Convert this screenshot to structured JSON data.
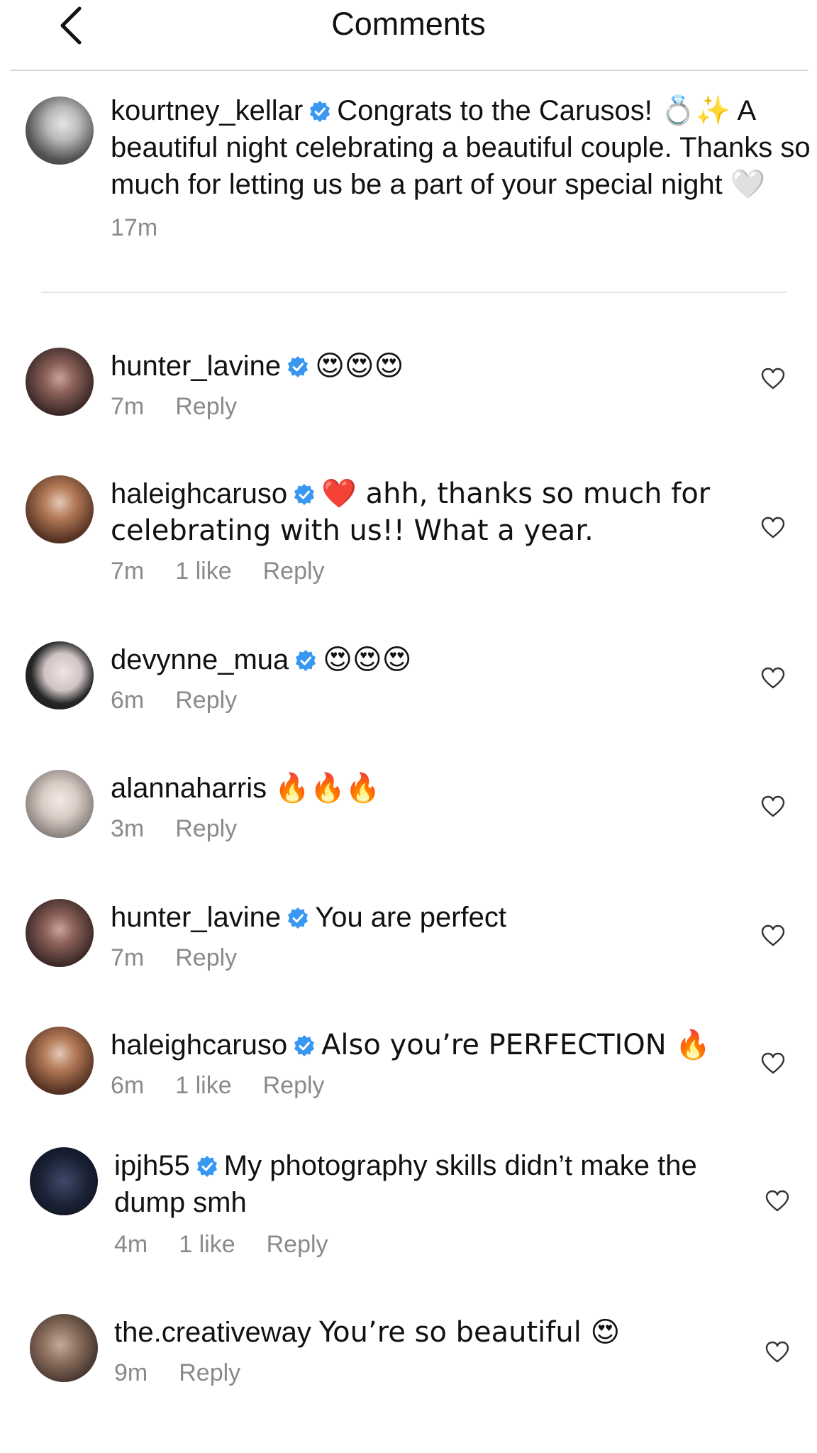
{
  "header": {
    "title": "Comments",
    "back_icon": "chevron-left-icon"
  },
  "caption": {
    "username": "kourtney_kellar",
    "verified": true,
    "text": "Congrats to the Carusos! 💍✨ A beautiful night celebrating a beautiful couple. Thanks so much for letting us be a part of your special night 🤍",
    "time": "17m"
  },
  "comments": [
    {
      "username": "hunter_lavine",
      "verified": true,
      "text": "😍😍😍",
      "time": "7m",
      "likes": "",
      "reply_label": "Reply"
    },
    {
      "username": "haleighcaruso",
      "verified": true,
      "text": "❤️ ahh, thanks so much for celebrating with us!! What a year.",
      "time": "7m",
      "likes": "1 like",
      "reply_label": "Reply"
    },
    {
      "username": "devynne_mua",
      "verified": true,
      "text": "😍😍😍",
      "time": "6m",
      "likes": "",
      "reply_label": "Reply"
    },
    {
      "username": "alannaharris",
      "verified": false,
      "text": "🔥🔥🔥",
      "time": "3m",
      "likes": "",
      "reply_label": "Reply"
    },
    {
      "username": "hunter_lavine",
      "verified": true,
      "text": "You are perfect",
      "time": "7m",
      "likes": "",
      "reply_label": "Reply"
    },
    {
      "username": "haleighcaruso",
      "verified": true,
      "text": "Also you’re PERFECTION 🔥",
      "time": "6m",
      "likes": "1 like",
      "reply_label": "Reply"
    },
    {
      "username": "ipjh55",
      "verified": true,
      "text": "My photography skills didn’t make the dump smh",
      "time": "4m",
      "likes": "1 like",
      "reply_label": "Reply"
    },
    {
      "username": "the.creativeway",
      "verified": false,
      "text": "You’re so beautiful 😍",
      "time": "9m",
      "likes": "",
      "reply_label": "Reply"
    }
  ],
  "colors": {
    "verified_badge": "#3897f0",
    "secondary_text": "#8a8a8a",
    "divider": "#d9d9d9"
  }
}
